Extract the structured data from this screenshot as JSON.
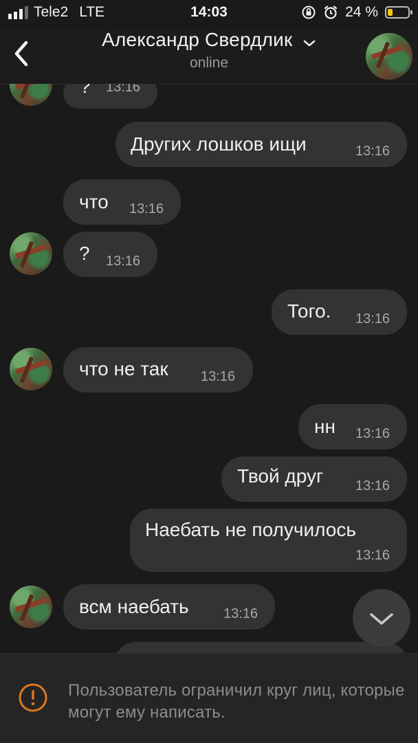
{
  "status_bar": {
    "carrier": "Tele2",
    "network": "LTE",
    "time": "14:03",
    "battery_percent": "24 %",
    "battery_level": 0.24,
    "signal_bars": 3,
    "battery_color": "#f6c20f"
  },
  "header": {
    "name": "Александр Свердлик",
    "status": "online"
  },
  "messages": [
    {
      "text": "?",
      "time": "13:16",
      "direction": "in"
    },
    {
      "text": "Других лошков ищи",
      "time": "13:16",
      "direction": "out"
    },
    {
      "text": "что",
      "time": "13:16",
      "direction": "in"
    },
    {
      "text": "?",
      "time": "13:16",
      "direction": "in"
    },
    {
      "text": "Того.",
      "time": "13:16",
      "direction": "out"
    },
    {
      "text": "что не так",
      "time": "13:16",
      "direction": "in"
    },
    {
      "text": "нн",
      "time": "13:16",
      "direction": "out"
    },
    {
      "text": "Твой друг",
      "time": "13:16",
      "direction": "out"
    },
    {
      "text": "Наебать не получилось",
      "time": "13:16",
      "direction": "out"
    },
    {
      "text": "всм наебать",
      "time": "13:16",
      "direction": "in"
    }
  ],
  "notice": {
    "text": "Пользователь ограничил круг лиц, которые могут ему написать.",
    "icon": "warning-circle-icon",
    "accent_color": "#e0781f"
  },
  "colors": {
    "background": "#1a1a1a",
    "bubble": "#333333"
  }
}
